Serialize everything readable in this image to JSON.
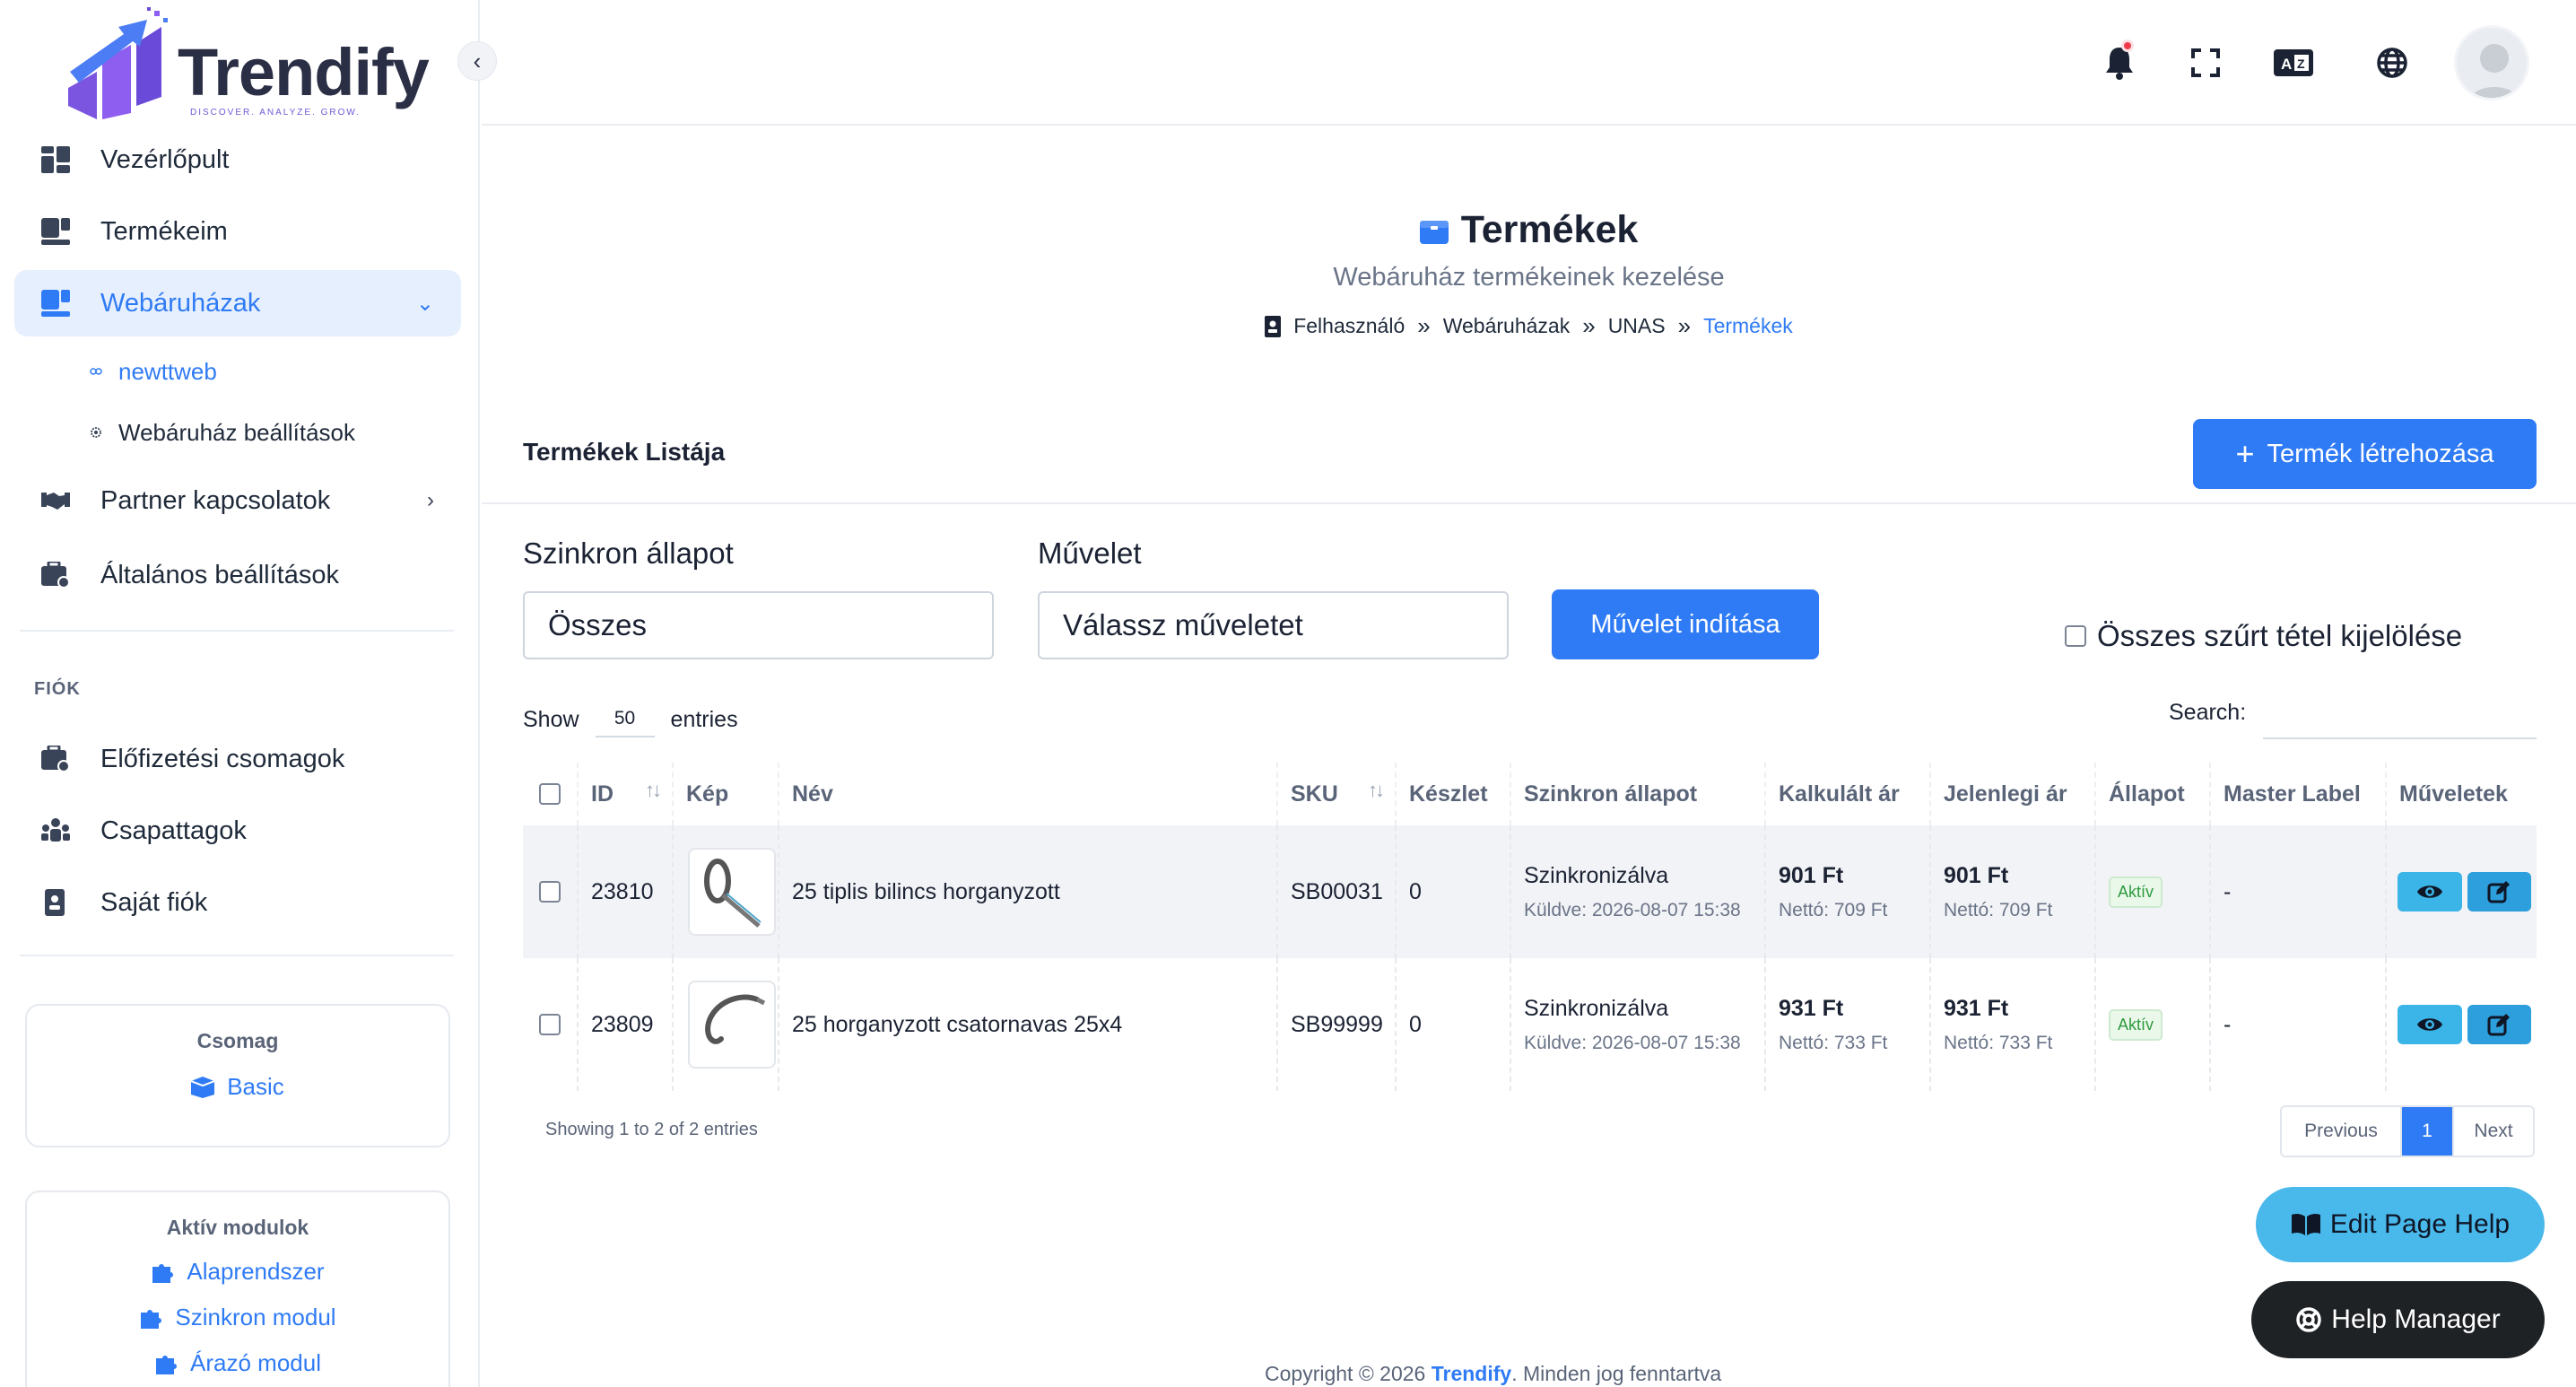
{
  "app": {
    "logo_text": "Trendify",
    "logo_tagline": "DISCOVER. ANALYZE. GROW."
  },
  "sidebar": {
    "items": [
      {
        "label": "Vezérlőpult"
      },
      {
        "label": "Termékeim"
      },
      {
        "label": "Webáruházak"
      },
      {
        "label": "Partner kapcsolatok"
      },
      {
        "label": "Általános beállítások"
      }
    ],
    "sub_items": [
      {
        "label": "newttweb"
      },
      {
        "label": "Webáruház beállítások"
      }
    ],
    "account_section": "FIÓK",
    "account_items": [
      {
        "label": "Előfizetési csomagok"
      },
      {
        "label": "Csapattagok"
      },
      {
        "label": "Saját fiók"
      }
    ],
    "package_card": {
      "title": "Csomag",
      "value": "Basic"
    },
    "modules_card": {
      "title": "Aktív modulok",
      "items": [
        "Alaprendszer",
        "Szinkron modul",
        "Árazó modul"
      ]
    }
  },
  "header": {
    "title": "Termékek",
    "subtitle": "Webáruház termékeinek kezelése",
    "breadcrumb": [
      "Felhasználó",
      "Webáruházak",
      "UNAS",
      "Termékek"
    ]
  },
  "content": {
    "list_title": "Termékek Listája",
    "create_button": "Termék létrehozása",
    "sync_label": "Szinkron állapot",
    "sync_value": "Összes",
    "action_label": "Művelet",
    "action_placeholder": "Válassz műveletet",
    "run_button": "Művelet indítása",
    "select_all_label": "Összes szűrt tétel kijelölése",
    "show_label": "Show",
    "show_value": "50",
    "entries_label": "entries",
    "search_label": "Search:"
  },
  "table": {
    "columns": [
      "ID",
      "Kép",
      "Név",
      "SKU",
      "Készlet",
      "Szinkron állapot",
      "Kalkulált ár",
      "Jelenlegi ár",
      "Állapot",
      "Master Label",
      "Műveletek"
    ],
    "rows": [
      {
        "id": "23810",
        "name": "25 tiplis bilincs horganyzott",
        "sku": "SB00031",
        "stock": "0",
        "sync": "Szinkronizálva",
        "sent": "Küldve: 2026-08-07 15:38",
        "calc_price": "901 Ft",
        "calc_net": "Nettó: 709 Ft",
        "cur_price": "901 Ft",
        "cur_net": "Nettó: 709 Ft",
        "status": "Aktív",
        "master": "-"
      },
      {
        "id": "23809",
        "name": "25 horganyzott csatornavas 25x4",
        "sku": "SB99999",
        "stock": "0",
        "sync": "Szinkronizálva",
        "sent": "Küldve: 2026-08-07 15:38",
        "calc_price": "931 Ft",
        "calc_net": "Nettó: 733 Ft",
        "cur_price": "931 Ft",
        "cur_net": "Nettó: 733 Ft",
        "status": "Aktív",
        "master": "-"
      }
    ],
    "info": "Showing 1 to 2 of 2 entries",
    "pager": {
      "prev": "Previous",
      "page": "1",
      "next": "Next"
    }
  },
  "help": {
    "edit": "Edit Page Help",
    "manager": "Help Manager"
  },
  "footer": {
    "prefix": "Copyright © 2026 ",
    "brand": "Trendify",
    "suffix": ". Minden jog fenntartva"
  },
  "colors": {
    "accent": "#2f7bf5",
    "active_bg": "#e6effd",
    "help_edit": "#49b8ea",
    "help_manager": "#1f2225",
    "badge_green": "#2d9a3e"
  }
}
